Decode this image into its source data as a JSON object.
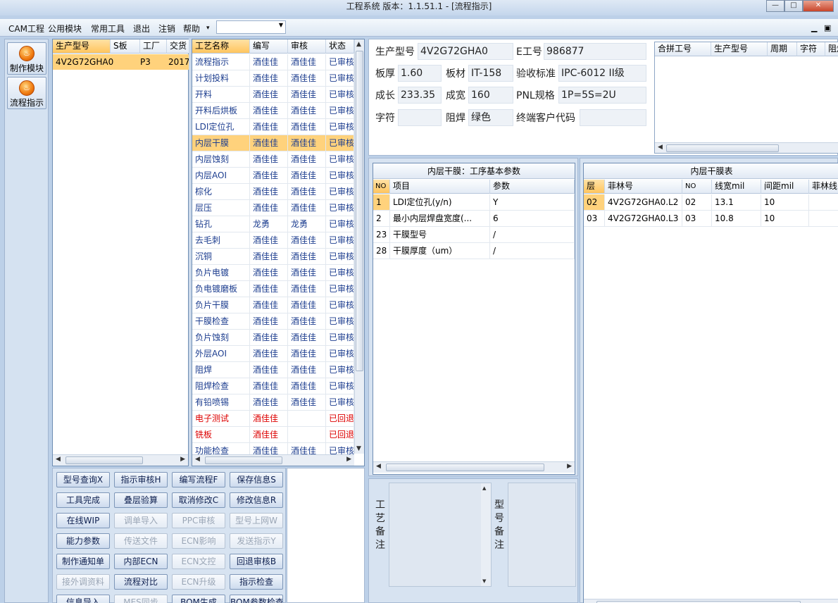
{
  "window": {
    "title": "工程系统   版本：1.1.51.1 - [流程指示]",
    "min": "—",
    "max": "□",
    "close": "✕"
  },
  "menu": {
    "items": [
      "CAM工程",
      "公用模块",
      "常用工具",
      "退出",
      "注销",
      "帮助"
    ],
    "help_arrow": "▾",
    "combo_value": "",
    "combo_arrow": "▼",
    "mdi_min": "▁",
    "mdi_restore": "▣"
  },
  "nav": [
    {
      "label": "制作模块",
      "icon": "fire"
    },
    {
      "label": "流程指示",
      "icon": "fire"
    }
  ],
  "grid1": {
    "headers": [
      "生产型号",
      "S板",
      "工厂",
      "交货"
    ],
    "rows": [
      [
        "4V2G72GHA0",
        "",
        "P3",
        "2017"
      ]
    ]
  },
  "grid2": {
    "headers": [
      "工艺名称",
      "编写",
      "审核",
      "状态"
    ],
    "rows": [
      [
        "流程指示",
        "酒佳佳",
        "酒佳佳",
        "已审核"
      ],
      [
        "计划投料",
        "酒佳佳",
        "酒佳佳",
        "已审核"
      ],
      [
        "开料",
        "酒佳佳",
        "酒佳佳",
        "已审核"
      ],
      [
        "开料后烘板",
        "酒佳佳",
        "酒佳佳",
        "已审核"
      ],
      [
        "LDI定位孔",
        "酒佳佳",
        "酒佳佳",
        "已审核"
      ],
      [
        "内层干膜",
        "酒佳佳",
        "酒佳佳",
        "已审核"
      ],
      [
        "内层蚀刻",
        "酒佳佳",
        "酒佳佳",
        "已审核"
      ],
      [
        "内层AOI",
        "酒佳佳",
        "酒佳佳",
        "已审核"
      ],
      [
        "棕化",
        "酒佳佳",
        "酒佳佳",
        "已审核"
      ],
      [
        "层压",
        "酒佳佳",
        "酒佳佳",
        "已审核"
      ],
      [
        "钻孔",
        "龙勇",
        "龙勇",
        "已审核"
      ],
      [
        "去毛刺",
        "酒佳佳",
        "酒佳佳",
        "已审核"
      ],
      [
        "沉铜",
        "酒佳佳",
        "酒佳佳",
        "已审核"
      ],
      [
        "负片电镀",
        "酒佳佳",
        "酒佳佳",
        "已审核"
      ],
      [
        "负电镀磨板",
        "酒佳佳",
        "酒佳佳",
        "已审核"
      ],
      [
        "负片干膜",
        "酒佳佳",
        "酒佳佳",
        "已审核"
      ],
      [
        "干膜检查",
        "酒佳佳",
        "酒佳佳",
        "已审核"
      ],
      [
        "负片蚀刻",
        "酒佳佳",
        "酒佳佳",
        "已审核"
      ],
      [
        "外层AOI",
        "酒佳佳",
        "酒佳佳",
        "已审核"
      ],
      [
        "阻焊",
        "酒佳佳",
        "酒佳佳",
        "已审核"
      ],
      [
        "阻焊检查",
        "酒佳佳",
        "酒佳佳",
        "已审核"
      ],
      [
        "有铅喷锡",
        "酒佳佳",
        "酒佳佳",
        "已审核"
      ],
      [
        "电子测试",
        "酒佳佳",
        "",
        "已回退"
      ],
      [
        "铣板",
        "酒佳佳",
        "",
        "已回退"
      ],
      [
        "功能检查",
        "酒佳佳",
        "酒佳佳",
        "已审核"
      ]
    ]
  },
  "buttons": [
    [
      "型号查询X",
      "指示审核H",
      "编写流程F",
      "保存信息S"
    ],
    [
      "工具完成",
      "叠层验算",
      "取消修改C",
      "修改信息R"
    ],
    [
      "在线WIP",
      "调单导入",
      "PPC审核",
      "型号上网W"
    ],
    [
      "能力参数",
      "传送文件",
      "ECN影响",
      "发送指示Y"
    ],
    [
      "制作通知单",
      "内部ECN",
      "ECN文控",
      "回退审核B"
    ],
    [
      "接外调资料",
      "流程对比",
      "ECN升级",
      "指示检查"
    ],
    [
      "信息导入",
      "MES同步",
      "BOM生成",
      "BOM参数检查"
    ]
  ],
  "info": {
    "model_lbl": "生产型号",
    "model": "4V2G72GHA0",
    "eno_lbl": "E工号",
    "eno": "986877",
    "thick_lbl": "板厚",
    "thick": "1.60",
    "mat_lbl": "板材",
    "mat": "IT-158",
    "std_lbl": "验收标准",
    "std": "IPC-6012 II级",
    "len_lbl": "成长",
    "len": "233.35",
    "wid_lbl": "成宽",
    "wid": "160",
    "pnl_lbl": "PNL规格",
    "pnl": "1P=5S=2U",
    "char_lbl": "字符",
    "char": "",
    "mask_lbl": "阻焊",
    "mask": "绿色",
    "cust_lbl": "终端客户代码",
    "cust": ""
  },
  "merge": {
    "headers": [
      "合拼工号",
      "生产型号",
      "周期",
      "字符",
      "阻焊"
    ]
  },
  "params": {
    "title": "内层干膜：工序基本参数",
    "headers": [
      "NO",
      "项目",
      "参数"
    ],
    "rows": [
      [
        "1",
        "LDI定位孔(y/n)",
        "Y"
      ],
      [
        "2",
        "最小内层焊盘宽度(...",
        "6"
      ],
      [
        "23",
        "干膜型号",
        "/"
      ],
      [
        "28",
        "干膜厚度（um）",
        "/"
      ]
    ]
  },
  "layers": {
    "title": "内层干膜表",
    "headers": [
      "层",
      "菲林号",
      "NO",
      "线宽mil",
      "间距mil",
      "菲林线"
    ],
    "rows": [
      [
        "02",
        "4V2G72GHA0.L2",
        "02",
        "13.1",
        "10",
        ""
      ],
      [
        "03",
        "4V2G72GHA0.L3",
        "03",
        "10.8",
        "10",
        ""
      ]
    ]
  },
  "notes": {
    "process_label": "工艺备注",
    "model_label": "型号备注"
  },
  "scroll": {
    "left": "◀",
    "right": "▶",
    "up": "▲",
    "down": "▼",
    "grip": "|||"
  }
}
